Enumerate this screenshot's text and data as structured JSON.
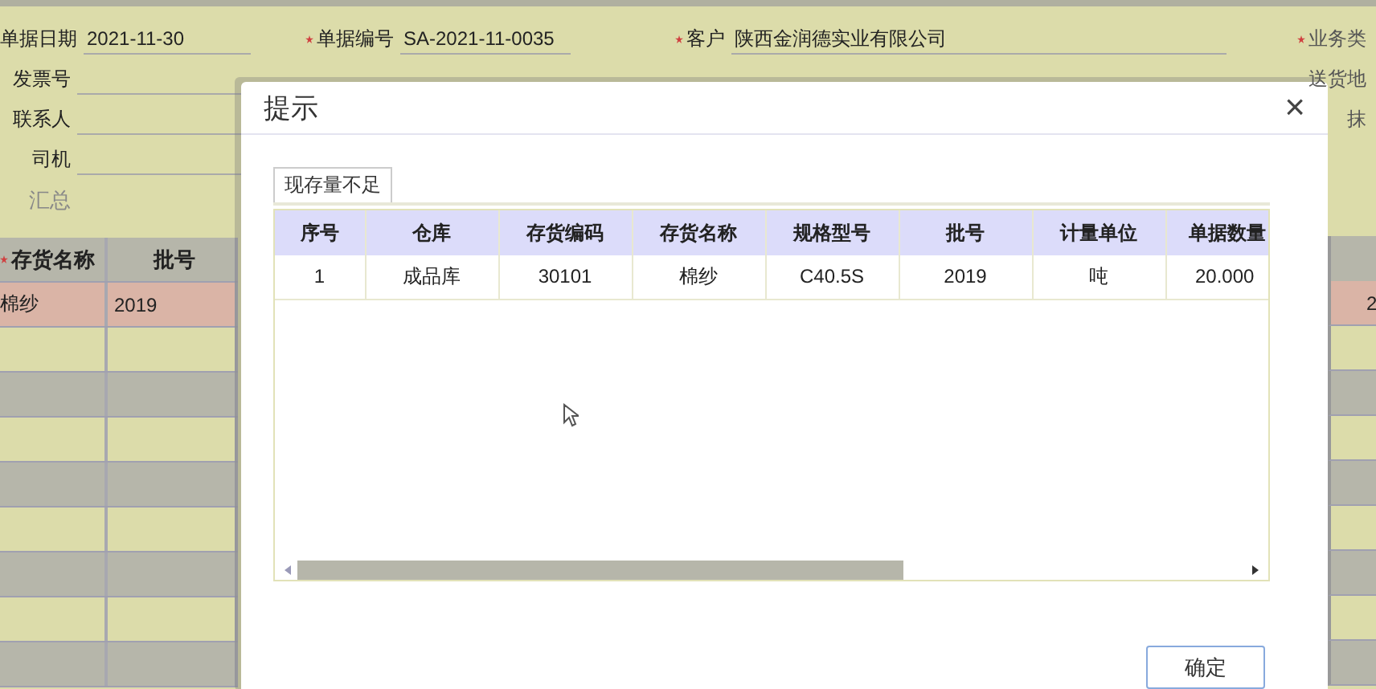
{
  "form": {
    "rows": [
      {
        "fields": [
          {
            "label": "单据日期",
            "value": "2021-11-30",
            "required": false,
            "kind": "field"
          },
          {
            "label": "单据编号",
            "value": "SA-2021-11-0035",
            "required": true,
            "kind": "field"
          },
          {
            "label": "客户",
            "value": "陕西金润德实业有限公司",
            "required": true,
            "kind": "field"
          },
          {
            "label": "业务类",
            "required": true,
            "kind": "label"
          }
        ]
      },
      {
        "fields": [
          {
            "label": "发票号",
            "kind": "field"
          },
          {
            "label": "送货地",
            "kind": "label"
          }
        ]
      },
      {
        "fields": [
          {
            "label": "联系人",
            "kind": "field"
          },
          {
            "label": "抹",
            "kind": "label"
          }
        ]
      },
      {
        "fields": [
          {
            "label": "司机",
            "kind": "field"
          }
        ]
      },
      {
        "fields": [
          {
            "label": "汇总",
            "kind": "tab"
          }
        ]
      }
    ]
  },
  "grid": {
    "columns": [
      {
        "label": "存货名称",
        "required": true
      },
      {
        "label": "批号",
        "required": false
      }
    ],
    "rows": [
      {
        "cells": [
          "棉纱",
          "2019"
        ],
        "selected": true,
        "right_cell": "2"
      },
      {
        "cells": [],
        "selected": false
      },
      {
        "cells": [],
        "selected": false
      },
      {
        "cells": [],
        "selected": false
      },
      {
        "cells": [],
        "selected": false
      },
      {
        "cells": [],
        "selected": false
      },
      {
        "cells": [],
        "selected": false
      },
      {
        "cells": [],
        "selected": false
      },
      {
        "cells": [],
        "selected": false
      }
    ]
  },
  "dialog": {
    "title": "提示",
    "close": "×",
    "tabs": [
      {
        "label": "现存量不足",
        "selected": true
      }
    ],
    "table": {
      "columns": [
        "序号",
        "仓库",
        "存货编码",
        "存货名称",
        "规格型号",
        "批号",
        "计量单位",
        "单据数量"
      ],
      "rows": [
        [
          "1",
          "成品库",
          "30101",
          "棉纱",
          "C40.5S",
          "2019",
          "吨",
          "20.000"
        ]
      ]
    },
    "buttons": [
      "确定"
    ]
  }
}
